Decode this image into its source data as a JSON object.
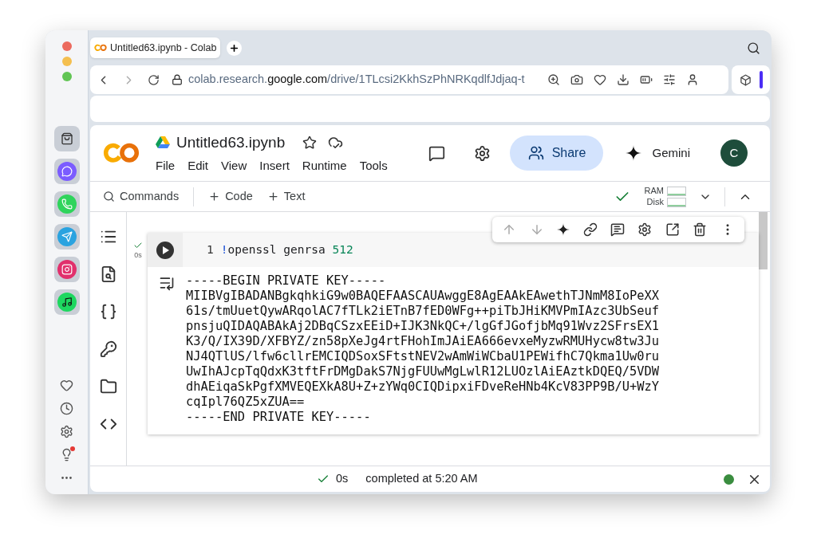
{
  "browser_tab": {
    "title": "Untitled63.ipynb - Colab",
    "selected": true
  },
  "address_bar": {
    "host_prefix": "colab.research.",
    "domain": "google.com",
    "path": "/drive/1TLcsi2KkhSzPhNRKqdlfJdjaq-t"
  },
  "notebook": {
    "title": "Untitled63.ipynb",
    "starred": false
  },
  "menu": [
    "File",
    "Edit",
    "View",
    "Insert",
    "Runtime",
    "Tools"
  ],
  "header": {
    "share": "Share",
    "gemini": "Gemini",
    "avatar": "C"
  },
  "toolbar": {
    "commands": "Commands",
    "add_code": "Code",
    "add_text": "Text",
    "connected": true,
    "meters": [
      {
        "label": "RAM"
      },
      {
        "label": "Disk"
      }
    ]
  },
  "cell": {
    "line_number": "1",
    "ran": true,
    "duration": "0s",
    "code": [
      {
        "kind": "bang",
        "text": "!"
      },
      {
        "kind": "plain",
        "text": "openssl genrsa "
      },
      {
        "kind": "number",
        "text": "512"
      }
    ],
    "output": [
      "-----BEGIN PRIVATE KEY-----",
      "MIIBVgIBADANBgkqhkiG9w0BAQEFAASCAUAwggE8AgEAAkEAwethTJNmM8IoPeXX",
      "61s/tmUuetQywARqolAC7fTLk2iETnB7fED0WFg++piTbJHiKMVPmIAzc3UbSeuf",
      "pnsjuQIDAQABAkAj2DBqCSzxEEiD+IJK3NkQC+/lgGfJGofjbMq91Wvz2SFrsEX1",
      "K3/Q/IX39D/XFBYZ/zn58pXeJg4rtFHohImJAiEA666evxeMyzwRMUHycw8tw3Ju",
      "NJ4QTlUS/lfw6cllrEMCIQDSoxSFtstNEV2wAmWiWCbaU1PEWifhC7Qkma1Uw0ru",
      "UwIhAJcpTqQdxK3tftFrDMgDakS7NjgFUUwMgLwlR12LUOzlAiEAztkDQEQ/5VDW",
      "dhAEiqaSkPgfXMVEQEXkA8U+Z+zYWq0CIQDipxiFDveReHNb4KcV83PP9B/U+WzY",
      "cqIpl76QZ5xZUA==",
      "-----END PRIVATE KEY-----"
    ]
  },
  "status_bar": {
    "duration": "0s",
    "message": "completed at 5:20 AM",
    "connected": true
  }
}
